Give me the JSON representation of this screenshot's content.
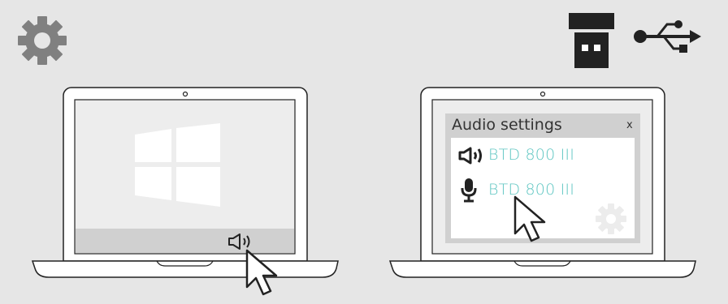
{
  "audio_settings": {
    "title": "Audio settings",
    "close_label": "x",
    "playback_device": "BTD 800 III",
    "recording_device": "BTD 800 III"
  },
  "icons": {
    "top_left": "gear-icon",
    "top_right": [
      "usb-dongle-icon",
      "usb-icon"
    ],
    "left_laptop": [
      "windows-logo-icon",
      "speaker-icon",
      "mouse-pointer-icon"
    ],
    "right_laptop": [
      "speaker-icon",
      "microphone-icon",
      "mouse-pointer-icon",
      "gear-icon"
    ]
  },
  "colors": {
    "background": "#e6e6e6",
    "icon_gray": "#808080",
    "device_text": "#5fc6c2",
    "outline": "#222222"
  }
}
